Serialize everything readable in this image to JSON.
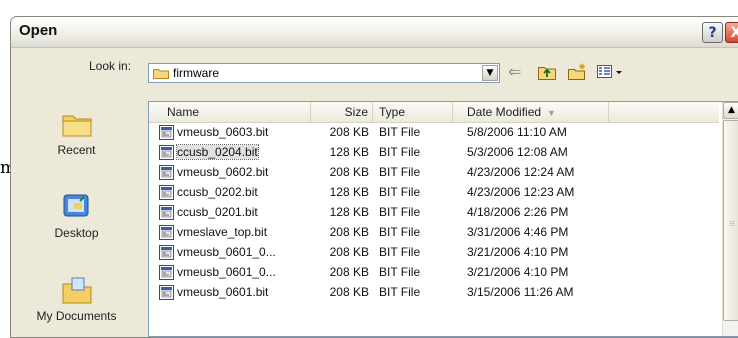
{
  "document_fragment": "m",
  "window": {
    "title": "Open",
    "help_label": "?",
    "close_label": "X"
  },
  "lookin": {
    "label": "Look in:",
    "value": "firmware"
  },
  "toolbar": {
    "back_glyph": "⇐"
  },
  "places": [
    {
      "label": "Recent",
      "icon": "recent-folder-icon"
    },
    {
      "label": "Desktop",
      "icon": "desktop-icon"
    },
    {
      "label": "My Documents",
      "icon": "my-documents-icon"
    }
  ],
  "columns": {
    "name": "Name",
    "size": "Size",
    "type": "Type",
    "date": "Date Modified",
    "sort_glyph": "▼"
  },
  "files": [
    {
      "name": "vmeusb_0603.bit",
      "size": "208 KB",
      "type": "BIT File",
      "date": "5/8/2006 11:10 AM",
      "selected": false
    },
    {
      "name": "ccusb_0204.bit",
      "size": "128 KB",
      "type": "BIT File",
      "date": "5/3/2006 12:08 AM",
      "selected": true
    },
    {
      "name": "vmeusb_0602.bit",
      "size": "208 KB",
      "type": "BIT File",
      "date": "4/23/2006 12:24 AM",
      "selected": false
    },
    {
      "name": "ccusb_0202.bit",
      "size": "128 KB",
      "type": "BIT File",
      "date": "4/23/2006 12:23 AM",
      "selected": false
    },
    {
      "name": "ccusb_0201.bit",
      "size": "128 KB",
      "type": "BIT File",
      "date": "4/18/2006 2:26 PM",
      "selected": false
    },
    {
      "name": "vmeslave_top.bit",
      "size": "208 KB",
      "type": "BIT File",
      "date": "3/31/2006 4:46 PM",
      "selected": false
    },
    {
      "name": "vmeusb_0601_0...",
      "size": "208 KB",
      "type": "BIT File",
      "date": "3/21/2006 4:10 PM",
      "selected": false
    },
    {
      "name": "vmeusb_0601_0...",
      "size": "208 KB",
      "type": "BIT File",
      "date": "3/21/2006 4:10 PM",
      "selected": false
    },
    {
      "name": "vmeusb_0601.bit",
      "size": "208 KB",
      "type": "BIT File",
      "date": "3/15/2006 11:26 AM",
      "selected": false
    }
  ],
  "colors": {
    "dialog_bg": "#ece9d8",
    "selection_bg": "#e1e1e1",
    "border": "#7f9db9"
  }
}
